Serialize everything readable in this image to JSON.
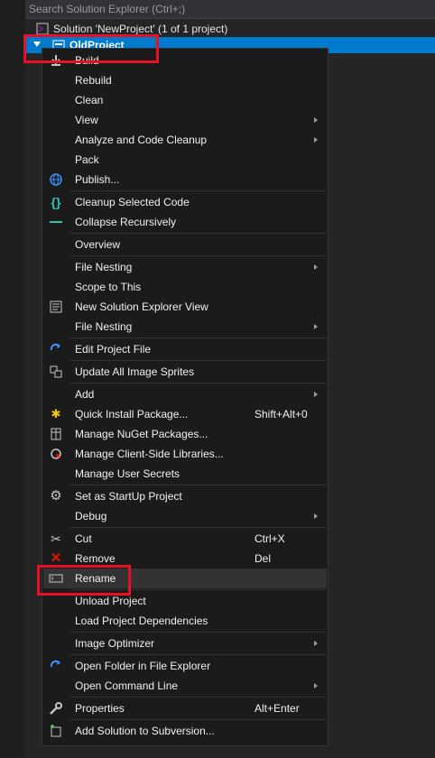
{
  "search": {
    "placeholder": "Search Solution Explorer (Ctrl+;)"
  },
  "tree": {
    "solution_label": "Solution 'NewProject' (1 of 1 project)",
    "project_label": "OldProject"
  },
  "menu": {
    "items": [
      {
        "label": "Build",
        "icon": "build-icon"
      },
      {
        "label": "Rebuild"
      },
      {
        "label": "Clean"
      },
      {
        "label": "View",
        "submenu": true
      },
      {
        "label": "Analyze and Code Cleanup",
        "submenu": true
      },
      {
        "label": "Pack"
      },
      {
        "label": "Publish...",
        "icon": "globe-icon"
      },
      {
        "label": "Cleanup Selected Code",
        "icon": "braces-icon"
      },
      {
        "label": "Collapse Recursively",
        "icon": "collapse-icon"
      },
      {
        "label": "Overview"
      },
      {
        "label": "File Nesting",
        "submenu": true
      },
      {
        "label": "Scope to This"
      },
      {
        "label": "New Solution Explorer View",
        "icon": "new-view-icon"
      },
      {
        "label": "File Nesting",
        "submenu": true
      },
      {
        "label": "Edit Project File",
        "icon": "refresh-arrow-icon"
      },
      {
        "label": "Update All Image Sprites",
        "icon": "sprites-icon"
      },
      {
        "label": "Add",
        "submenu": true
      },
      {
        "label": "Quick Install Package...",
        "icon": "quick-install-icon",
        "shortcut": "Shift+Alt+0"
      },
      {
        "label": "Manage NuGet Packages...",
        "icon": "nuget-icon"
      },
      {
        "label": "Manage Client-Side Libraries...",
        "icon": "libraries-icon"
      },
      {
        "label": "Manage User Secrets"
      },
      {
        "label": "Set as StartUp Project",
        "icon": "gear-icon"
      },
      {
        "label": "Debug",
        "submenu": true
      },
      {
        "label": "Cut",
        "icon": "scissors-icon",
        "shortcut": "Ctrl+X"
      },
      {
        "label": "Remove",
        "icon": "close-icon",
        "shortcut": "Del"
      },
      {
        "label": "Rename",
        "icon": "rename-icon"
      },
      {
        "label": "Unload Project"
      },
      {
        "label": "Load Project Dependencies"
      },
      {
        "label": "Image Optimizer",
        "submenu": true
      },
      {
        "label": "Open Folder in File Explorer",
        "icon": "refresh-arrow-icon"
      },
      {
        "label": "Open Command Line",
        "submenu": true
      },
      {
        "label": "Properties",
        "icon": "wrench-icon",
        "shortcut": "Alt+Enter"
      },
      {
        "label": "Add Solution to Subversion...",
        "icon": "subversion-icon"
      }
    ]
  },
  "colors": {
    "accent": "#007acc",
    "highlight": "#e81123",
    "menu_bg": "#1b1b1c"
  }
}
